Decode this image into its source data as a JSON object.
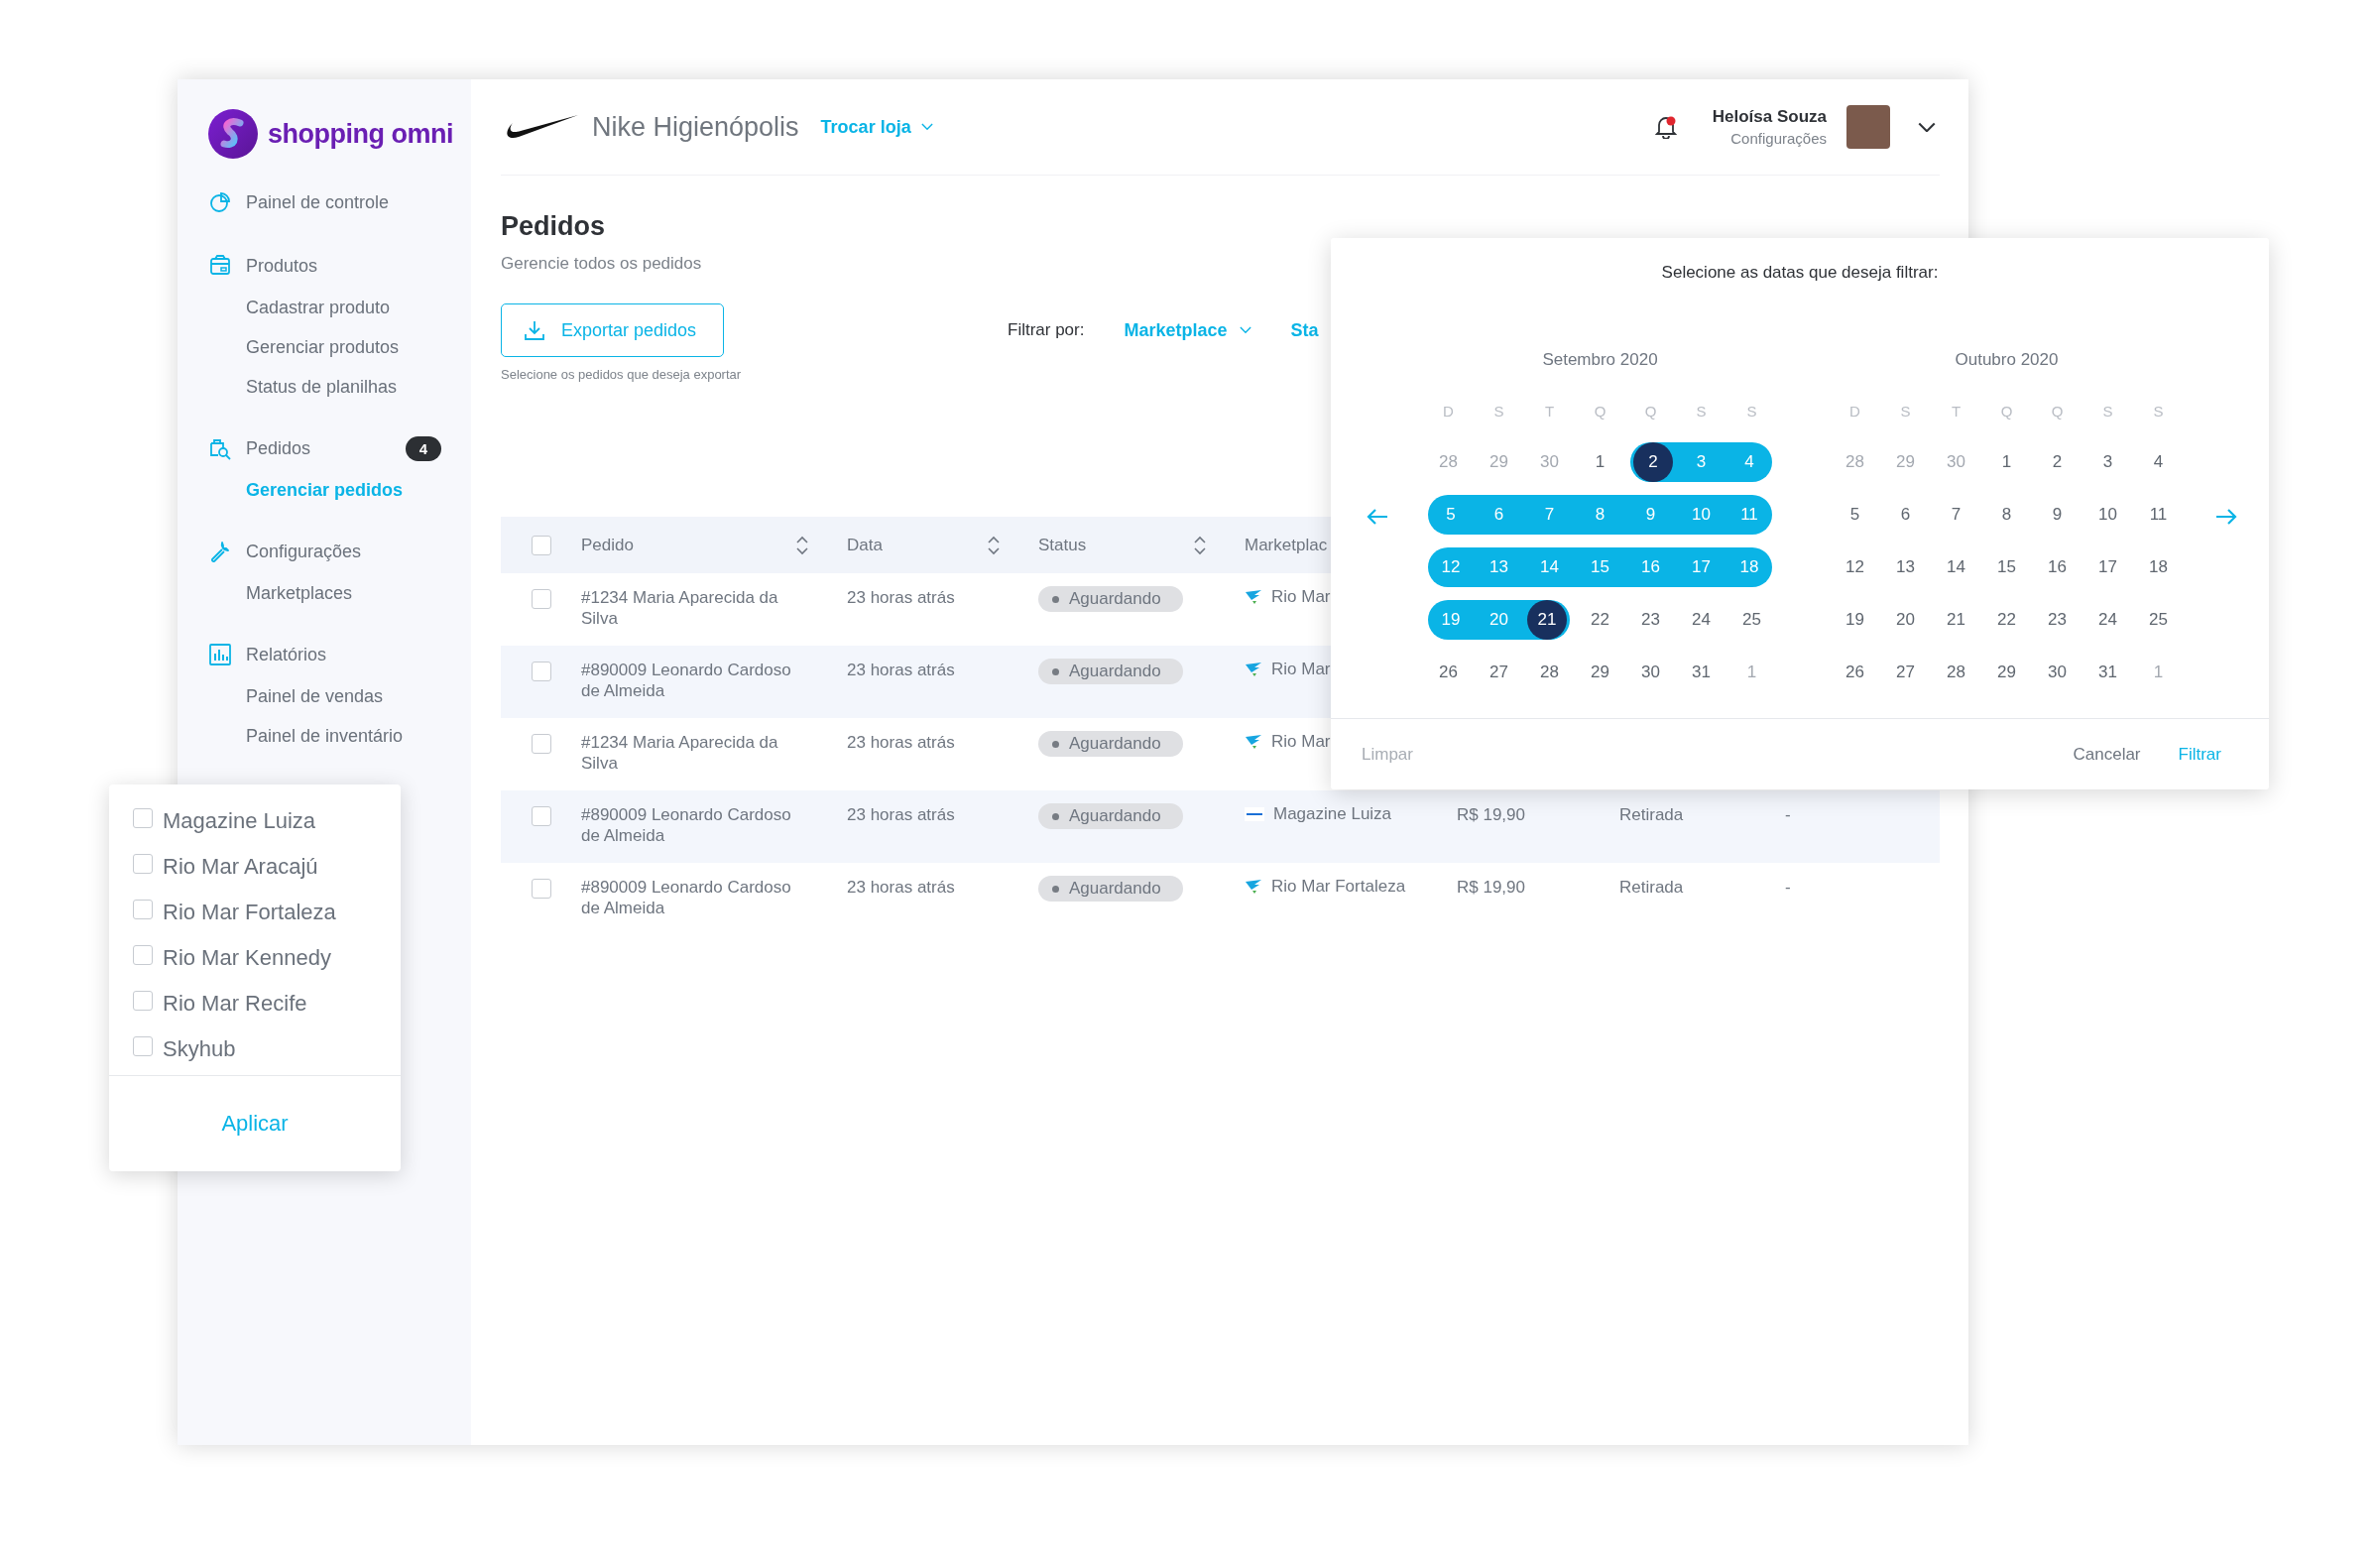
{
  "brand": {
    "name": "shopping omni"
  },
  "sidebar": {
    "items": [
      {
        "label": "Painel de controle"
      },
      {
        "label": "Produtos",
        "children": [
          {
            "label": "Cadastrar produto",
            "selected": false
          },
          {
            "label": "Gerenciar produtos",
            "selected": false
          },
          {
            "label": "Status de planilhas",
            "selected": false
          }
        ]
      },
      {
        "label": "Pedidos",
        "badge": "4",
        "children": [
          {
            "label": "Gerenciar pedidos",
            "selected": true
          }
        ]
      },
      {
        "label": "Configurações",
        "children": [
          {
            "label": "Marketplaces",
            "selected": false
          }
        ]
      },
      {
        "label": "Relatórios",
        "children": [
          {
            "label": "Painel de vendas",
            "selected": false
          },
          {
            "label": "Painel de inventário",
            "selected": false
          }
        ]
      }
    ]
  },
  "header": {
    "store": "Nike Higienópolis",
    "switch_store": "Trocar loja",
    "notification": {
      "unread": true
    },
    "user": {
      "name": "Heloísa Souza",
      "subtitle": "Configurações"
    }
  },
  "page": {
    "title": "Pedidos",
    "subtitle": "Gerencie todos os pedidos",
    "export_button": "Exportar pedidos",
    "export_hint": "Selecione os pedidos que deseja exportar",
    "filter": {
      "label": "Filtrar por:",
      "options": [
        "Marketplace",
        "Sta"
      ]
    }
  },
  "table": {
    "select_all": {
      "checked": false
    },
    "columns": [
      {
        "label": "Pedido",
        "sortable": true
      },
      {
        "label": "Data",
        "sortable": true
      },
      {
        "label": "Status",
        "sortable": true
      },
      {
        "label": "Marketplac"
      }
    ],
    "rows": [
      {
        "checked": false,
        "order": "#1234 Maria Aparecida da Silva",
        "date": "23 horas atrás",
        "status": "Aguardando",
        "marketplace": "Rio Mar",
        "kind": "bird"
      },
      {
        "checked": false,
        "order": "#890009 Leonardo Cardoso de Almeida",
        "date": "23 horas atrás",
        "status": "Aguardando",
        "marketplace": "Rio Mar",
        "kind": "bird"
      },
      {
        "checked": false,
        "order": "#1234 Maria Aparecida da Silva",
        "date": "23 horas atrás",
        "status": "Aguardando",
        "marketplace": "Rio Mar",
        "kind": "bird"
      },
      {
        "checked": false,
        "order": "#890009 Leonardo Cardoso de Almeida",
        "date": "23 horas atrás",
        "status": "Aguardando",
        "marketplace": "Magazine Luiza",
        "kind": "wordmark",
        "column_5": "R$ 19,90",
        "column_6": "Retirada",
        "column_7": "-"
      },
      {
        "checked": false,
        "order": "#890009 Leonardo Cardoso de Almeida",
        "date": "23 horas atrás",
        "status": "Aguardando",
        "marketplace": "Rio Mar Fortaleza",
        "kind": "bird",
        "column_5": "R$ 19,90",
        "column_6": "Retirada",
        "column_7": "-"
      }
    ]
  },
  "date_picker": {
    "title": "Selecione as datas que deseja filtrar:",
    "months": [
      {
        "title": "Setembro 2020",
        "weekdays": [
          "D",
          "S",
          "T",
          "Q",
          "Q",
          "S",
          "S"
        ],
        "days": [
          {
            "label": "28",
            "kind": "outside"
          },
          {
            "label": "29",
            "kind": "outside"
          },
          {
            "label": "30",
            "kind": "outside"
          },
          {
            "label": "1",
            "kind": "day"
          },
          {
            "label": "2",
            "kind": "start"
          },
          {
            "label": "3",
            "kind": "range"
          },
          {
            "label": "4",
            "kind": "range"
          },
          {
            "label": "5",
            "kind": "range"
          },
          {
            "label": "6",
            "kind": "range"
          },
          {
            "label": "7",
            "kind": "range"
          },
          {
            "label": "8",
            "kind": "range"
          },
          {
            "label": "9",
            "kind": "range"
          },
          {
            "label": "10",
            "kind": "range"
          },
          {
            "label": "11",
            "kind": "range"
          },
          {
            "label": "12",
            "kind": "range"
          },
          {
            "label": "13",
            "kind": "range"
          },
          {
            "label": "14",
            "kind": "range"
          },
          {
            "label": "15",
            "kind": "range"
          },
          {
            "label": "16",
            "kind": "range"
          },
          {
            "label": "17",
            "kind": "range"
          },
          {
            "label": "18",
            "kind": "range"
          },
          {
            "label": "19",
            "kind": "range"
          },
          {
            "label": "20",
            "kind": "range"
          },
          {
            "label": "21",
            "kind": "end"
          },
          {
            "label": "22",
            "kind": "day"
          },
          {
            "label": "23",
            "kind": "day"
          },
          {
            "label": "24",
            "kind": "day"
          },
          {
            "label": "25",
            "kind": "day"
          },
          {
            "label": "26",
            "kind": "day"
          },
          {
            "label": "27",
            "kind": "day"
          },
          {
            "label": "28",
            "kind": "day"
          },
          {
            "label": "29",
            "kind": "day"
          },
          {
            "label": "30",
            "kind": "day"
          },
          {
            "label": "31",
            "kind": "day"
          },
          {
            "label": "1",
            "kind": "outside"
          }
        ]
      },
      {
        "title": "Outubro 2020",
        "weekdays": [
          "D",
          "S",
          "T",
          "Q",
          "Q",
          "S",
          "S"
        ],
        "days": [
          {
            "label": "28",
            "kind": "outside"
          },
          {
            "label": "29",
            "kind": "outside"
          },
          {
            "label": "30",
            "kind": "outside"
          },
          {
            "label": "1",
            "kind": "day"
          },
          {
            "label": "2",
            "kind": "day"
          },
          {
            "label": "3",
            "kind": "day"
          },
          {
            "label": "4",
            "kind": "day"
          },
          {
            "label": "5",
            "kind": "day"
          },
          {
            "label": "6",
            "kind": "day"
          },
          {
            "label": "7",
            "kind": "day"
          },
          {
            "label": "8",
            "kind": "day"
          },
          {
            "label": "9",
            "kind": "day"
          },
          {
            "label": "10",
            "kind": "day"
          },
          {
            "label": "11",
            "kind": "day"
          },
          {
            "label": "12",
            "kind": "day"
          },
          {
            "label": "13",
            "kind": "day"
          },
          {
            "label": "14",
            "kind": "day"
          },
          {
            "label": "15",
            "kind": "day"
          },
          {
            "label": "16",
            "kind": "day"
          },
          {
            "label": "17",
            "kind": "day"
          },
          {
            "label": "18",
            "kind": "day"
          },
          {
            "label": "19",
            "kind": "day"
          },
          {
            "label": "20",
            "kind": "day"
          },
          {
            "label": "21",
            "kind": "day"
          },
          {
            "label": "22",
            "kind": "day"
          },
          {
            "label": "23",
            "kind": "day"
          },
          {
            "label": "24",
            "kind": "day"
          },
          {
            "label": "25",
            "kind": "day"
          },
          {
            "label": "26",
            "kind": "day"
          },
          {
            "label": "27",
            "kind": "day"
          },
          {
            "label": "28",
            "kind": "day"
          },
          {
            "label": "29",
            "kind": "day"
          },
          {
            "label": "30",
            "kind": "day"
          },
          {
            "label": "31",
            "kind": "day"
          },
          {
            "label": "1",
            "kind": "outside"
          }
        ]
      }
    ],
    "clear": {
      "label": "Limpar",
      "disabled": true
    },
    "cancel": "Cancelar",
    "apply": "Filtrar"
  },
  "marketplace_dropdown": {
    "options": [
      {
        "label": "Magazine Luiza",
        "checked": false
      },
      {
        "label": "Rio Mar Aracajú",
        "checked": false
      },
      {
        "label": "Rio Mar Fortaleza",
        "checked": false
      },
      {
        "label": "Rio Mar Kennedy",
        "checked": false
      },
      {
        "label": "Rio Mar Recife",
        "checked": false
      },
      {
        "label": "Skyhub",
        "checked": false
      }
    ],
    "apply": "Aplicar"
  }
}
